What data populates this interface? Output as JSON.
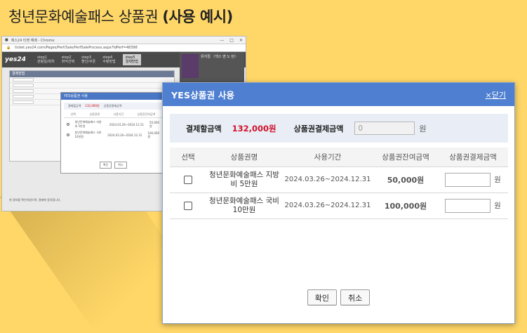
{
  "headline": {
    "regular": "청년문화예술패스 상품권 ",
    "bold": "(사용 예시)"
  },
  "browser": {
    "window_title": "예스24 티켓 예매 - Chrome",
    "url": "ticket.yes24.com/Pages/Perf/Sale/PerfSaleProcess.aspx?IdPerf=48398",
    "logo": "yes24",
    "steps": [
      {
        "num": "step1",
        "label": "관람일/회차"
      },
      {
        "num": "step2",
        "label": "좌석선택"
      },
      {
        "num": "step3",
        "label": "할인/쿠폰"
      },
      {
        "num": "step4",
        "label": "수령방법"
      },
      {
        "num": "step5",
        "label": "결제방법"
      }
    ],
    "book_title": "뮤지컬 〈섹스 앤 노 탄〉",
    "panel_header": "결제방법",
    "sub_title": "YES상품권 사용",
    "sub_pay_label": "결제할금액",
    "sub_pay_value": "132,000원",
    "sub_gc_label": "상품권결제금액",
    "sub_headers": [
      "선택",
      "상품권명",
      "사용기간",
      "상품권잔여금액"
    ],
    "sub_rows": [
      {
        "name": "청년문화예술패스 지방비 5만원",
        "period": "2024.03.26~2024.12.31",
        "remain": "50,000원"
      },
      {
        "name": "청년문화예술패스 국비 10만원",
        "period": "2024.03.26~2024.12.31",
        "remain": "100,000원"
      }
    ],
    "sub_confirm": "확인",
    "sub_cancel": "취소",
    "bottom_text": "위 정보를 확인하였으며, 결제에 동의합니다."
  },
  "dialog": {
    "title": "YES상품권 사용",
    "close_label": "×닫기",
    "pay_label": "결제할금액",
    "pay_value": "132,000원",
    "gc_label": "상품권결제금액",
    "gc_value": "0",
    "won": "원",
    "headers": [
      "선택",
      "상품권명",
      "사용기간",
      "상품권잔여금액",
      "상품권결제금액"
    ],
    "rows": [
      {
        "name": "청년문화예술패스 지방비 5만원",
        "period": "2024.03.26~2024.12.31",
        "remain": "50,000원"
      },
      {
        "name": "청년문화예술패스 국비 10만원",
        "period": "2024.03.26~2024.12.31",
        "remain": "100,000원"
      }
    ],
    "confirm_label": "확인",
    "cancel_label": "취소"
  }
}
